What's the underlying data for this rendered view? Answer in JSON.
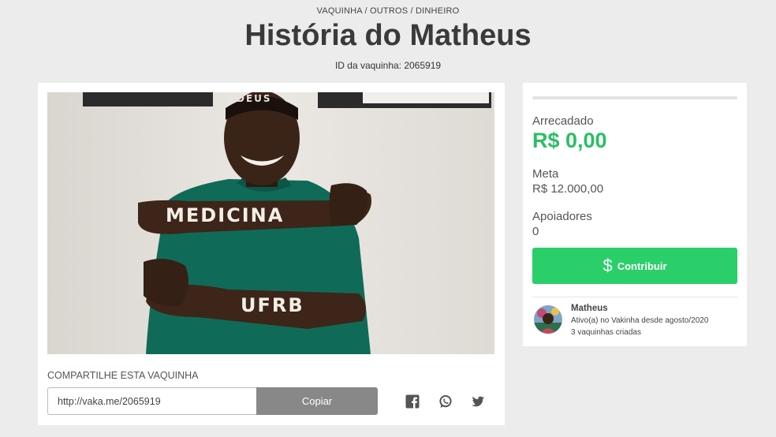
{
  "header": {
    "breadcrumb": "VAQUINHA / OUTROS / DINHEIRO",
    "title": "História do Matheus",
    "id_line": "ID da vaquinha: 2065919"
  },
  "photo": {
    "arm_text_1": "MEDICINA",
    "arm_text_2": "UFRB",
    "head_text": "DEUS"
  },
  "share": {
    "label": "COMPARTILHE ESTA VAQUINHA",
    "url": "http://vaka.me/2065919",
    "copy_label": "Copiar",
    "icons": [
      "facebook-icon",
      "whatsapp-icon",
      "twitter-icon"
    ]
  },
  "stats": {
    "progress_fraction": 0,
    "raised_label": "Arrecadado",
    "raised_value": "R$ 0,00",
    "goal_label": "Meta",
    "goal_value": "R$ 12.000,00",
    "supporters_label": "Apoiadores",
    "supporters_value": "0",
    "contribute_label": "Contribuir"
  },
  "creator": {
    "name": "Matheus",
    "active_since": "Ativo(a) no Vakinha desde agosto/2020",
    "campaigns": "3 vaquinhas criadas"
  },
  "colors": {
    "page_bg": "#ececec",
    "accent_green": "#2bcf6a",
    "amount_green": "#2bbf63",
    "copy_button": "#888888"
  }
}
